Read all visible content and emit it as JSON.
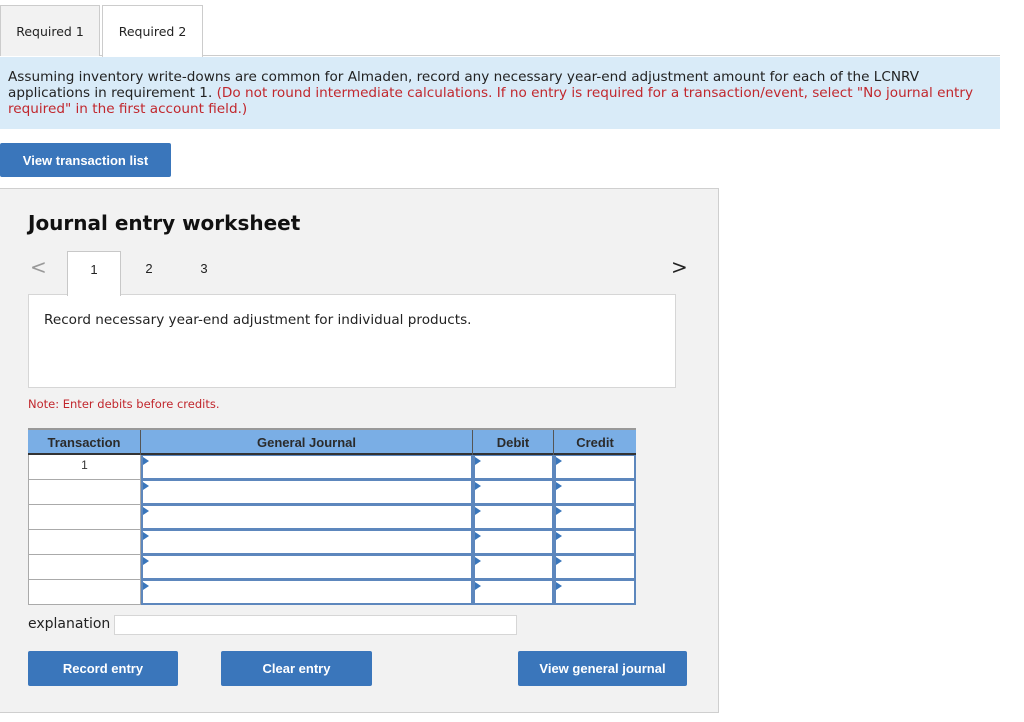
{
  "tabs": [
    {
      "label": "Required 1",
      "active": false
    },
    {
      "label": "Required 2",
      "active": true
    }
  ],
  "instructions": {
    "text": "Assuming inventory write-downs are common for Almaden, record any necessary year-end adjustment amount for each of the LCNRV applications in requirement 1.",
    "note": "(Do not round intermediate calculations. If no entry is required for a transaction/event, select \"No journal entry required\" in the first account field.)"
  },
  "buttons": {
    "view_transaction_list": "View transaction list",
    "record_entry": "Record entry",
    "clear_entry": "Clear entry",
    "view_general_journal": "View general journal"
  },
  "worksheet": {
    "title": "Journal entry worksheet",
    "prev_icon": "<",
    "next_icon": ">",
    "steps": [
      "1",
      "2",
      "3"
    ],
    "active_step": "1",
    "description": "Record necessary year-end adjustment for individual products.",
    "note": "Note: Enter debits before credits.",
    "table": {
      "headers": [
        "Transaction",
        "General Journal",
        "Debit",
        "Credit"
      ],
      "rows": [
        {
          "transaction": "1",
          "account": "",
          "debit": "",
          "credit": ""
        },
        {
          "transaction": "",
          "account": "",
          "debit": "",
          "credit": ""
        },
        {
          "transaction": "",
          "account": "",
          "debit": "",
          "credit": ""
        },
        {
          "transaction": "",
          "account": "",
          "debit": "",
          "credit": ""
        },
        {
          "transaction": "",
          "account": "",
          "debit": "",
          "credit": ""
        },
        {
          "transaction": "",
          "account": "",
          "debit": "",
          "credit": ""
        }
      ]
    },
    "explanation_label": "explanation",
    "explanation_value": ""
  },
  "colors": {
    "button_blue": "#3a76bb",
    "header_blue": "#7aaee5",
    "instruction_bg": "#d9ebf8",
    "note_red": "#c1272d"
  }
}
